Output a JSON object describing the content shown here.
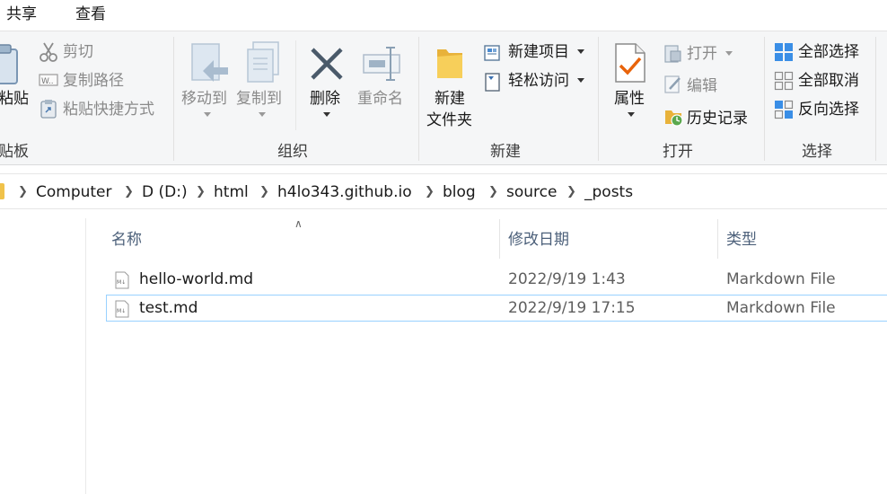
{
  "tabs": [
    {
      "label": "共享"
    },
    {
      "label": "查看"
    }
  ],
  "ribbon": {
    "clipboard": {
      "paste_label": "粘贴",
      "cut_label": "剪切",
      "copy_path_label": "复制路径",
      "paste_shortcut_label": "粘贴快捷方式",
      "group_label": "贴板"
    },
    "organize": {
      "move_to_label": "移动到",
      "copy_to_label": "复制到",
      "delete_label": "删除",
      "rename_label": "重命名",
      "group_label": "组织"
    },
    "new": {
      "new_folder_line1": "新建",
      "new_folder_line2": "文件夹",
      "new_item_label": "新建项目",
      "easy_access_label": "轻松访问",
      "group_label": "新建"
    },
    "open": {
      "properties_label": "属性",
      "open_label": "打开",
      "edit_label": "编辑",
      "history_label": "历史记录",
      "group_label": "打开"
    },
    "select": {
      "select_all_label": "全部选择",
      "select_none_label": "全部取消",
      "invert_label": "反向选择",
      "group_label": "选择"
    }
  },
  "breadcrumb": [
    {
      "label": "Computer"
    },
    {
      "label": "D (D:)"
    },
    {
      "label": "html"
    },
    {
      "label": "h4lo343.github.io"
    },
    {
      "label": "blog"
    },
    {
      "label": "source"
    },
    {
      "label": "_posts"
    }
  ],
  "columns": {
    "name": "名称",
    "modified": "修改日期",
    "type": "类型"
  },
  "files": [
    {
      "name": "hello-world.md",
      "modified": "2022/9/19 1:43",
      "type": "Markdown File"
    },
    {
      "name": "test.md",
      "modified": "2022/9/19 17:15",
      "type": "Markdown File"
    }
  ],
  "icons": {
    "paste": "clipboard-icon",
    "cut": "scissors-icon",
    "copy_path": "copy-path-icon",
    "paste_shortcut": "paste-shortcut-icon",
    "move_to": "move-to-icon",
    "copy_to": "copy-to-icon",
    "delete": "delete-x-icon",
    "rename": "rename-icon",
    "new_folder": "folder-icon",
    "new_item": "new-item-icon",
    "easy_access": "easy-access-icon",
    "properties": "properties-check-icon",
    "open": "open-icon",
    "edit": "edit-icon",
    "history": "history-icon",
    "select_all": "select-all-icon",
    "select_none": "select-none-icon",
    "invert": "invert-selection-icon",
    "file": "markdown-file-icon"
  },
  "colors": {
    "ribbon_bg": "#f5f6f7",
    "header_text": "#4c607a",
    "focus_border": "#99d1ff",
    "accent_blue": "#1e88e5",
    "delete_gray": "#4a5a6a",
    "check_orange": "#e8630a"
  }
}
